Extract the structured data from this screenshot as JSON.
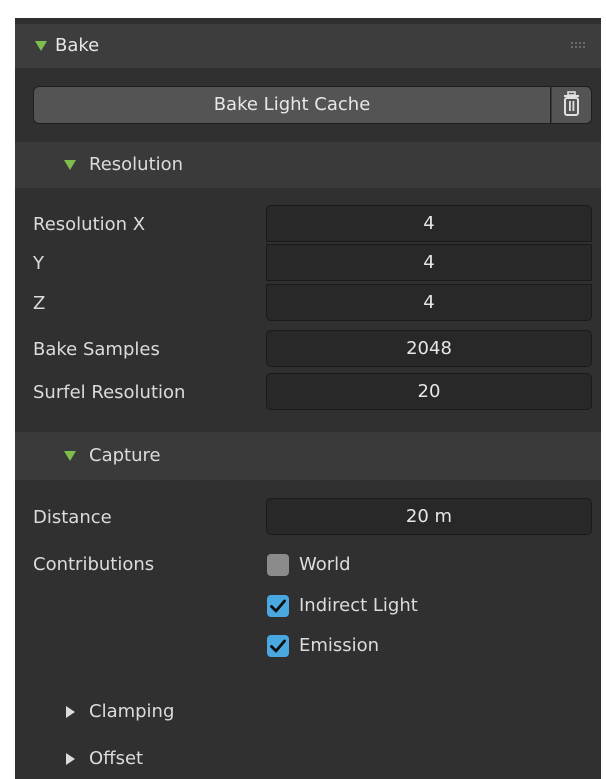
{
  "panel": {
    "title": "Bake",
    "bake_button_label": "Bake Light Cache",
    "delete_icon": "trash-icon"
  },
  "resolution": {
    "title": "Resolution",
    "rows": [
      {
        "label": "Resolution X",
        "value": "4"
      },
      {
        "label": "Y",
        "value": "4"
      },
      {
        "label": "Z",
        "value": "4"
      },
      {
        "label": "Bake Samples",
        "value": "2048"
      },
      {
        "label": "Surfel Resolution",
        "value": "20"
      }
    ]
  },
  "capture": {
    "title": "Capture",
    "distance_label": "Distance",
    "distance_value": "20 m",
    "contributions_label": "Contributions",
    "checkboxes": [
      {
        "label": "World",
        "checked": false
      },
      {
        "label": "Indirect Light",
        "checked": true
      },
      {
        "label": "Emission",
        "checked": true
      }
    ]
  },
  "collapsed": {
    "clamping": "Clamping",
    "offset": "Offset"
  },
  "colors": {
    "accent_green": "#7ebc4c",
    "checkbox_blue": "#4aa8e0"
  }
}
